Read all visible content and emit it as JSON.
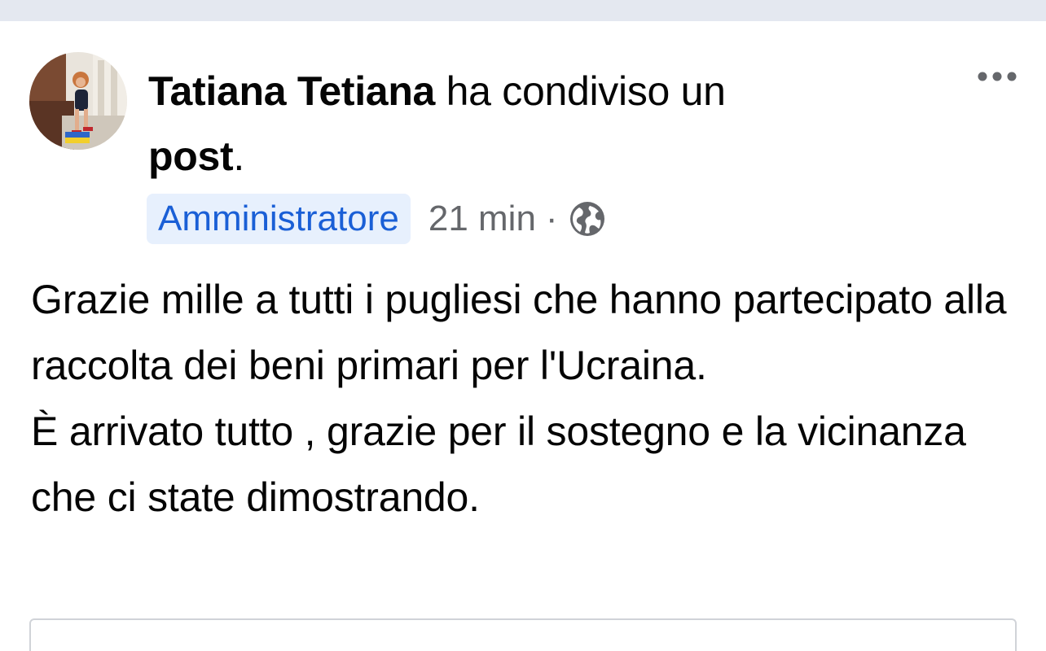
{
  "post": {
    "author_name": "Tatiana Tetiana",
    "action_text": " ha condiviso un ",
    "object_text": "post",
    "period": ".",
    "role_badge": "Amministratore",
    "timestamp": "21 min",
    "separator": "·",
    "audience_icon": "globe-icon",
    "more_icon": "more-options-icon",
    "body_paragraphs": [
      "Grazie mille a tutti i pugliesi che hanno partecipato alla raccolta dei beni primari per l'Ucraina.",
      "È arrivato tutto , grazie per il sostegno e la vicinanza che ci state dimostrando."
    ]
  },
  "colors": {
    "badge_bg": "#e7f0fd",
    "badge_text": "#1a5fd6",
    "secondary_text": "#65676b",
    "top_band": "#e4e8f0"
  }
}
